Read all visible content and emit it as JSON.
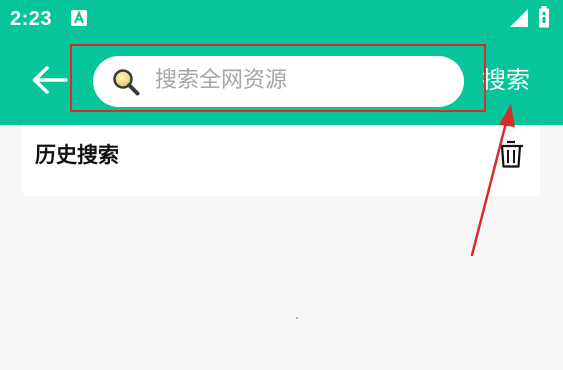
{
  "status_bar": {
    "time": "2:23",
    "notification_icon": "a-letter-icon",
    "signal_icon": "signal-icon",
    "battery_icon": "battery-icon"
  },
  "header": {
    "back_icon": "arrow-left-icon",
    "search": {
      "placeholder": "搜索全网资源",
      "value": "",
      "icon": "magnifier-icon"
    },
    "search_button_label": "搜索"
  },
  "history": {
    "title": "历史搜索",
    "clear_icon": "trash-icon"
  },
  "colors": {
    "header_bg": "#06c59b",
    "page_bg": "#f7f7f7",
    "annotation": "#d62c2c"
  }
}
